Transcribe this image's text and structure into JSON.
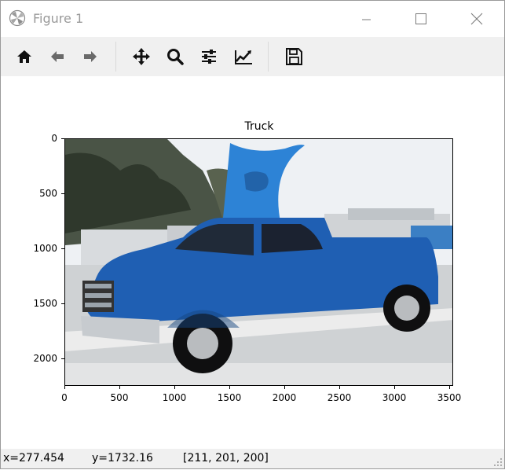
{
  "window": {
    "title": "Figure 1",
    "controls": [
      "minimize",
      "maximize",
      "close"
    ]
  },
  "toolbar": {
    "buttons": [
      {
        "name": "home",
        "icon": "home-icon"
      },
      {
        "name": "back",
        "icon": "arrow-left-icon"
      },
      {
        "name": "forward",
        "icon": "arrow-right-icon"
      },
      {
        "name": "pan",
        "icon": "move-icon"
      },
      {
        "name": "zoom",
        "icon": "magnifier-icon"
      },
      {
        "name": "configure-subplots",
        "icon": "sliders-icon"
      },
      {
        "name": "edit-axis",
        "icon": "line-chart-icon"
      },
      {
        "name": "save",
        "icon": "floppy-disk-icon"
      }
    ]
  },
  "plot": {
    "title": "Truck",
    "image_description_label": "blue pickup truck with shark fin",
    "y_ticks": [
      "0",
      "500",
      "1000",
      "1500",
      "2000"
    ],
    "x_ticks": [
      "0",
      "500",
      "1000",
      "1500",
      "2000",
      "2500",
      "3000",
      "3500"
    ]
  },
  "chart_data": {
    "type": "image",
    "title": "Truck",
    "xlim": [
      0,
      3520
    ],
    "ylim": [
      2250,
      0
    ],
    "x_ticks": [
      0,
      500,
      1000,
      1500,
      2000,
      2500,
      3000,
      3500
    ],
    "y_ticks": [
      0,
      500,
      1000,
      1500,
      2000
    ],
    "grid": false
  },
  "status": {
    "x": "x=277.454",
    "y": "y=1732.16",
    "rgb": "[211, 201, 200]"
  },
  "colors": {
    "truck_blue": "#1f5fb3",
    "fin_blue": "#2d83d6",
    "sky": "#e8edf2"
  }
}
